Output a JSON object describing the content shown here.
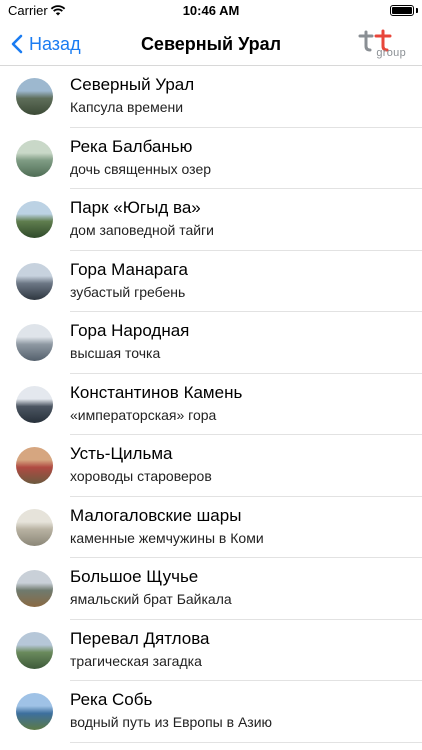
{
  "status": {
    "carrier": "Carrier",
    "time": "10:46 AM"
  },
  "nav": {
    "back_label": "Назад",
    "title": "Северный Урал",
    "logo_text": "group"
  },
  "colors": {
    "accent": "#1a7cf2",
    "logo_red": "#e8463a",
    "logo_gray": "#8a8f94"
  },
  "items": [
    {
      "title": "Северный Урал",
      "subtitle": "Капсула времени",
      "thumb": [
        "#9db8cf",
        "#5e6e5a",
        "#3c4a36"
      ]
    },
    {
      "title": "Река Балбанью",
      "subtitle": "дочь священных озер",
      "thumb": [
        "#c9d8c8",
        "#7f9c84",
        "#4f6d55"
      ]
    },
    {
      "title": "Парк «Югыд ва»",
      "subtitle": "дом заповедной тайги",
      "thumb": [
        "#bcd2e4",
        "#5f7d4e",
        "#2f4a2a"
      ]
    },
    {
      "title": "Гора Манарага",
      "subtitle": "зубастый гребень",
      "thumb": [
        "#c7d2de",
        "#6c7785",
        "#2e3640"
      ]
    },
    {
      "title": "Гора Народная",
      "subtitle": "высшая точка",
      "thumb": [
        "#dfe4ea",
        "#8e98a2",
        "#54606c"
      ]
    },
    {
      "title": "Константинов Камень",
      "subtitle": "«императорская» гора",
      "thumb": [
        "#e4e8ee",
        "#4c5662",
        "#27303a"
      ]
    },
    {
      "title": "Усть-Цильма",
      "subtitle": "хороводы староверов",
      "thumb": [
        "#d6a680",
        "#b04a42",
        "#6b5a3f"
      ]
    },
    {
      "title": "Малогаловские шары",
      "subtitle": "каменные жемчужины в Коми",
      "thumb": [
        "#e6e3da",
        "#b8b2a2",
        "#8b8778"
      ]
    },
    {
      "title": "Большое Щучье",
      "subtitle": "ямальский брат Байкала",
      "thumb": [
        "#c9d0d8",
        "#6f7a6e",
        "#8a6a43"
      ]
    },
    {
      "title": "Перевал Дятлова",
      "subtitle": "трагическая загадка",
      "thumb": [
        "#b6c7d8",
        "#6a8a5c",
        "#3e5a3a"
      ]
    },
    {
      "title": "Река Собь",
      "subtitle": "водный путь из Европы в Азию",
      "thumb": [
        "#9fc2e6",
        "#3d6f9e",
        "#5d7a46"
      ]
    }
  ]
}
